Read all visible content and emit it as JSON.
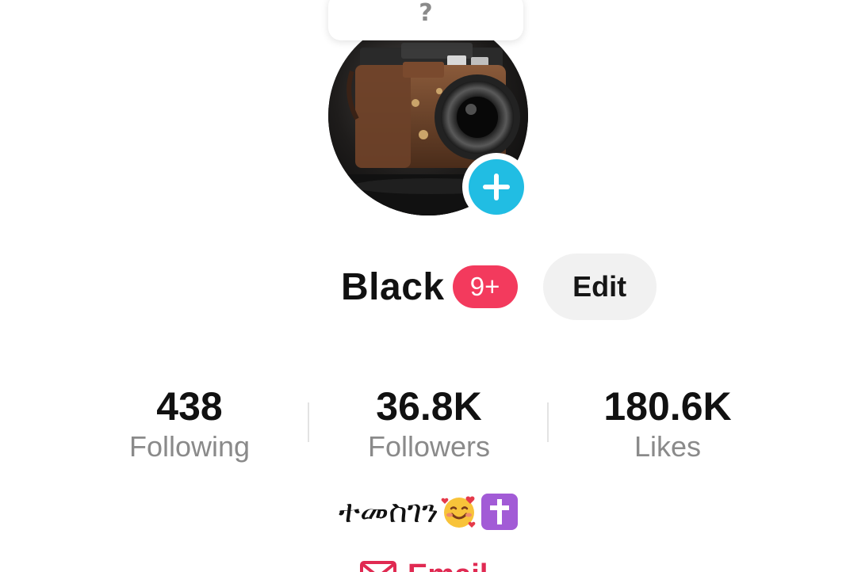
{
  "tooltip": {
    "text": "?"
  },
  "profile": {
    "username": "Black",
    "notification_badge": "9+",
    "edit_label": "Edit"
  },
  "stats": {
    "following": {
      "value": "438",
      "label": "Following"
    },
    "followers": {
      "value": "36.8K",
      "label": "Followers"
    },
    "likes": {
      "value": "180.6K",
      "label": "Likes"
    }
  },
  "bio": {
    "text": "ተመስገን"
  },
  "contact": {
    "email_label": "Email"
  },
  "colors": {
    "accent_add": "#21bde3",
    "badge": "#f33a5d",
    "email": "#e02a52",
    "muted_text": "#8a8a8a",
    "edit_bg": "#f1f1f1"
  },
  "icons": {
    "avatar": "camera-photo",
    "add": "plus-icon",
    "bio_emoji_1": "smiling-face-with-hearts-icon",
    "bio_emoji_2": "latin-cross-icon",
    "email": "envelope-icon"
  }
}
